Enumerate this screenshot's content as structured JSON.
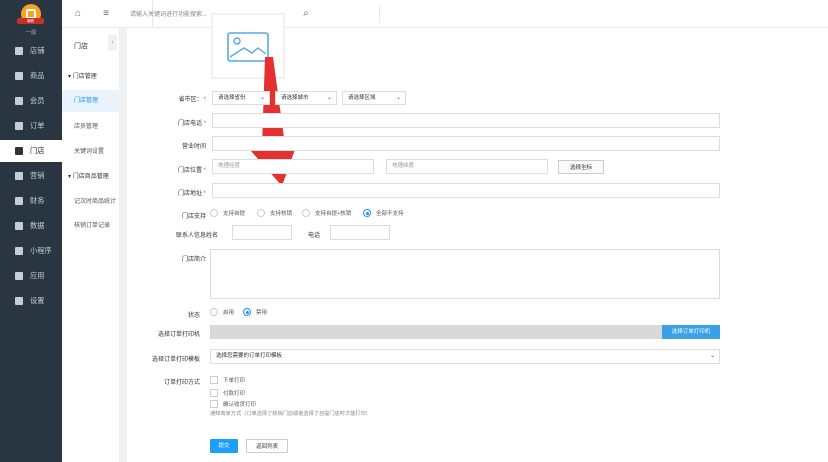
{
  "brand": {
    "badge": "编辑",
    "sub_label": "一级"
  },
  "nav": {
    "items": [
      {
        "label": "店铺",
        "icon": "store-icon"
      },
      {
        "label": "商品",
        "icon": "goods-icon"
      },
      {
        "label": "会员",
        "icon": "user-icon"
      },
      {
        "label": "订单",
        "icon": "order-icon"
      },
      {
        "label": "门店",
        "icon": "shop-icon"
      },
      {
        "label": "营销",
        "icon": "marketing-icon"
      },
      {
        "label": "财务",
        "icon": "finance-icon"
      },
      {
        "label": "数据",
        "icon": "chart-icon"
      },
      {
        "label": "小程序",
        "icon": "miniprogram-icon"
      },
      {
        "label": "应用",
        "icon": "apps-icon"
      },
      {
        "label": "设置",
        "icon": "gear-icon"
      }
    ],
    "active_index": 4
  },
  "topbar": {
    "search_placeholder": "请输入关键词进行功能搜索..."
  },
  "subnav": {
    "title": "门店",
    "collapse_glyph": "‹",
    "items": [
      {
        "label": "门店管理",
        "kind": "group"
      },
      {
        "label": "门店管理",
        "kind": "active"
      },
      {
        "label": "店员管理",
        "kind": "item"
      },
      {
        "label": "关键词设置",
        "kind": "item"
      },
      {
        "label": "门店商品管理",
        "kind": "group"
      },
      {
        "label": "记次时商品统计",
        "kind": "item"
      },
      {
        "label": "核销订单记录",
        "kind": "item"
      }
    ]
  },
  "form": {
    "region_label": "省市区：",
    "province_placeholder": "请选择省份",
    "city_placeholder": "请选择城市",
    "district_placeholder": "请选择区域",
    "phone_label": "门店电话",
    "hours_label": "营业时间",
    "location_label": "门店位置",
    "lng_placeholder": "地理经度",
    "lat_placeholder": "地理纬度",
    "pick_coord_button": "选择坐标",
    "address_label": "门店地址",
    "support_label": "门店支持",
    "support_options": [
      "支持自提",
      "支持核销",
      "支持自提+核销",
      "全部不支持"
    ],
    "support_selected": 3,
    "contact_label": "联系人信息",
    "contact_name_label": "姓名",
    "contact_phone_label": "电话",
    "intro_label": "门店简介",
    "status_label": "状态",
    "status_options": [
      "启用",
      "禁用"
    ],
    "status_selected": 1,
    "printer_label": "选择订单打印机",
    "printer_button": "选择订单打印机",
    "template_label": "选择订单打印模板",
    "template_placeholder": "选择您需要的订单打印模板",
    "print_mode_label": "订单打印方式",
    "print_modes": [
      "下单打印",
      "付款打印",
      "确认收货打印"
    ],
    "print_note": "通知商家方式（订单选择了核销门店或者选择了自提门店时才能打印）",
    "submit_button": "提交",
    "back_button": "返回列表"
  },
  "colors": {
    "sidebar": "#2a3542",
    "primary": "#1e9fff",
    "active_sub_text": "#1890ff",
    "arrow": "#e53030",
    "required": "#e84a4a"
  }
}
